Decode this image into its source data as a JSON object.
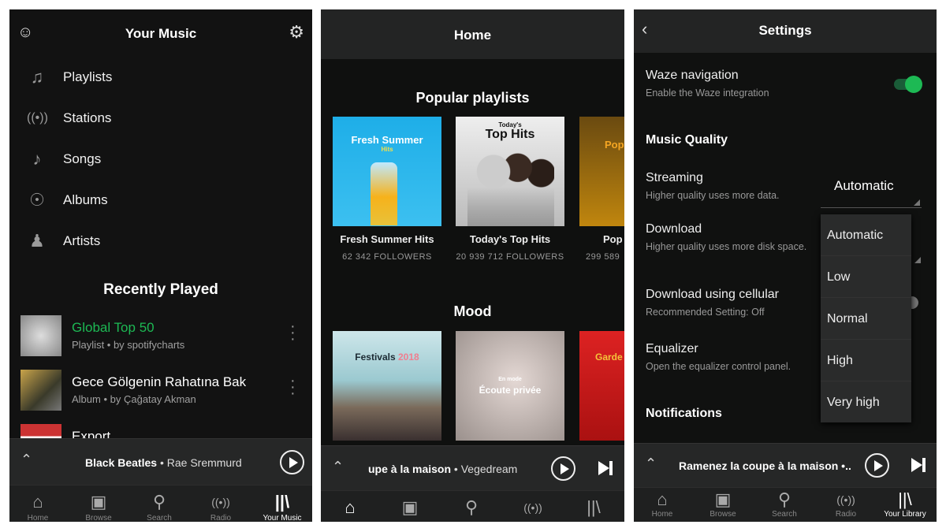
{
  "panel1": {
    "title": "Your Music",
    "menu": [
      {
        "label": "Playlists",
        "icon": "music-note-double"
      },
      {
        "label": "Stations",
        "icon": "radio-waves"
      },
      {
        "label": "Songs",
        "icon": "music-note"
      },
      {
        "label": "Albums",
        "icon": "disc"
      },
      {
        "label": "Artists",
        "icon": "person"
      }
    ],
    "recent_title": "Recently Played",
    "recent": [
      {
        "title": "Global Top 50",
        "subtitle": "Playlist • by spotifycharts"
      },
      {
        "title": "Gece Gölgenin Rahatına Bak",
        "subtitle": "Album • by Çağatay Akman"
      },
      {
        "title": "Export",
        "subtitle": ""
      }
    ],
    "now_playing": {
      "track": "Black Beatles",
      "artist": " • Rae Sremmurd"
    },
    "nav": [
      "Home",
      "Browse",
      "Search",
      "Radio",
      "Your Music"
    ]
  },
  "panel2": {
    "title": "Home",
    "popular_title": "Popular playlists",
    "popular": [
      {
        "cover_text": "Fresh Summer",
        "cover_sub": "Hits",
        "name": "Fresh Summer Hits",
        "followers": "62 342 FOLLOWERS"
      },
      {
        "cover_pre": "Today's",
        "cover_text": "Top Hits",
        "name": "Today's Top Hits",
        "followers": "20 939 712 FOLLOWERS"
      },
      {
        "cover_text": "Pop",
        "name": "Pop",
        "followers": "299 589"
      }
    ],
    "mood_title": "Mood",
    "mood": [
      {
        "cover_text": "Festivals",
        "cover_year": "2018"
      },
      {
        "cover_pre": "En mode",
        "cover_text": "Écoute privée"
      },
      {
        "cover_text": "Garde"
      }
    ],
    "now_playing": {
      "track": "upe à la maison",
      "artist": " • Vegedream"
    }
  },
  "panel3": {
    "title": "Settings",
    "waze": {
      "title": "Waze navigation",
      "subtitle": "Enable the Waze integration",
      "enabled": true
    },
    "music_quality": "Music Quality",
    "streaming": {
      "title": "Streaming",
      "subtitle": "Higher quality uses more data.",
      "value": "Automatic"
    },
    "download": {
      "title": "Download",
      "subtitle": "Higher quality uses more disk space."
    },
    "cellular": {
      "title": "Download using cellular",
      "subtitle": "Recommended Setting: Off"
    },
    "equalizer": {
      "title": "Equalizer",
      "subtitle": "Open the equalizer control panel."
    },
    "notifications": "Notifications",
    "dropdown_options": [
      "Automatic",
      "Low",
      "Normal",
      "High",
      "Very high"
    ],
    "now_playing": {
      "track": "Ramenez la coupe à la maison •.."
    },
    "nav": [
      "Home",
      "Browse",
      "Search",
      "Radio",
      "Your Library"
    ]
  },
  "colors": {
    "accent": "#1db954",
    "background": "#121212"
  }
}
